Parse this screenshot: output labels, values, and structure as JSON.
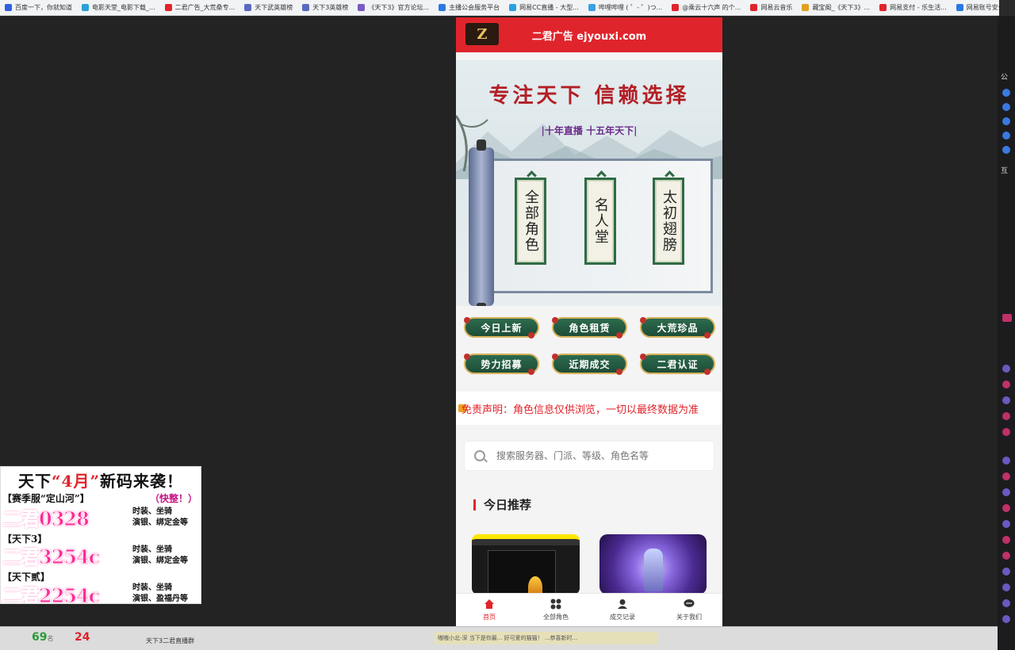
{
  "bookmarks": [
    {
      "label": "百度一下，你就知道",
      "color": "#3060e0"
    },
    {
      "label": "电影天堂_电影下载_...",
      "color": "#2aa0d8"
    },
    {
      "label": "二君广告_大荒桑专...",
      "color": "#e0242b"
    },
    {
      "label": "天下武英雄榜",
      "color": "#5a6ac0"
    },
    {
      "label": "天下3英雄榜",
      "color": "#5a6ac0"
    },
    {
      "label": "《天下3》官方论坛...",
      "color": "#7a5ac0"
    },
    {
      "label": "主播公会服务平台",
      "color": "#2a7ae0"
    },
    {
      "label": "网易CC直播 - 大型...",
      "color": "#2aa0e0"
    },
    {
      "label": "哔哩哔哩 ( ゜- ゜)つ...",
      "color": "#3aa0e0"
    },
    {
      "label": "@乘云十六声 的个...",
      "color": "#e0242b"
    },
    {
      "label": "网易云音乐",
      "color": "#e0242b"
    },
    {
      "label": "藏宝阁_《天下3》...",
      "color": "#e0a020"
    },
    {
      "label": "网易支付 - 乐生活...",
      "color": "#e0242b"
    },
    {
      "label": "网易账号安全",
      "color": "#2a7ae0"
    }
  ],
  "site": {
    "header_title": "二君广告 ejyouxi.com",
    "logo_text": "Z"
  },
  "banner": {
    "slogan": "专注天下 信赖选择",
    "subline": "|十年直播 十五年天下|",
    "plaques": [
      "全部角色",
      "名人堂",
      "太初翅膀"
    ]
  },
  "quick_buttons": [
    "今日上新",
    "角色租赁",
    "大荒珍品",
    "势力招募",
    "近期成交",
    "二君认证"
  ],
  "notice": {
    "text": "免责声明：角色信息仅供浏览，一切以最终数据为准"
  },
  "search": {
    "placeholder": "搜索服务器、门派、等级、角色名等"
  },
  "section": {
    "title": "今日推荐"
  },
  "tabbar": [
    {
      "label": "首页",
      "icon": "home-icon",
      "active": true
    },
    {
      "label": "全部角色",
      "icon": "grid-icon",
      "active": false
    },
    {
      "label": "成交记录",
      "icon": "user-icon",
      "active": false
    },
    {
      "label": "关于我们",
      "icon": "chat-icon",
      "active": false
    }
  ],
  "ad": {
    "head_pre": "天下",
    "head_hl": "“4月”",
    "head_post": "新码来袭！",
    "row1_left": "【赛季服“定山河”】",
    "row1_right": "（快整！）",
    "code1": "二君0328",
    "note1_line1": "时装、坐骑",
    "note1_line2": "演银、绑定金等",
    "tag2": "【天下3】",
    "code2": "二君3254c",
    "note2_line1": "时装、坐骑",
    "note2_line2": "演银、绑定金等",
    "tag3": "【天下贰】",
    "code3": "二君2254c",
    "note3_line1": "时装、坐骑",
    "note3_line2": "演银、盈福丹等"
  },
  "bottombar": {
    "count1": "69",
    "count1_unit": "名",
    "count2": "24",
    "room": "天下3二君直播群",
    "ticker": "嗷嗷小北-深 当下是你最...  好可爱的猫猫！  ...恭喜新时..."
  },
  "colors": {
    "brand_red": "#e0242b",
    "button_green": "#1e4d37",
    "button_gold": "#d8b25a",
    "ad_pink": "#ff2b96"
  }
}
